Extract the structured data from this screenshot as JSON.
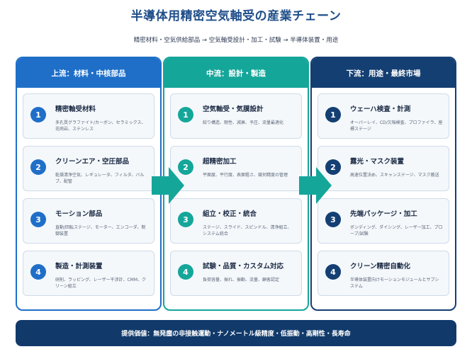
{
  "title": "半導体用精密空気軸受の産業チェーン",
  "subtitle": "精密材料・空気供給部品 → 空気軸受設計・加工・試験 → 半導体装置・用途",
  "colors": {
    "upstream": "#1f6fc8",
    "midstream": "#15a69a",
    "downstream": "#143f73"
  },
  "columns": [
    {
      "header": "上流：材料・中核部品",
      "items": [
        {
          "num": "1",
          "title": "精密軸受材料",
          "desc": "多孔質グラファイト/カーボン、セラミックス、花崗岩、ステンレス"
        },
        {
          "num": "2",
          "title": "クリーンエア・空圧部品",
          "desc": "乾燥清浄空気、レギュレータ、フィルタ、バルブ、配管"
        },
        {
          "num": "3",
          "title": "モーション部品",
          "desc": "直動/回転ステージ、モーター、エンコーダ、制御装置"
        },
        {
          "num": "4",
          "title": "製造・計測装置",
          "desc": "研削、ラッピング、レーザー干渉計、CMM、クリーン組立"
        }
      ]
    },
    {
      "header": "中流：設計・製造",
      "items": [
        {
          "num": "1",
          "title": "空気軸受・気膜設計",
          "desc": "絞り構造、剛性、減衰、予圧、流量最適化"
        },
        {
          "num": "2",
          "title": "超精密加工",
          "desc": "平面度、平行度、表面粗さ、幾何精度の管理"
        },
        {
          "num": "3",
          "title": "組立・校正・統合",
          "desc": "ステージ、スライド、スピンドル、清浄組立、システム統合"
        },
        {
          "num": "4",
          "title": "試験・品質・カスタム対応",
          "desc": "負荷容量、振れ、振動、流量、顧客認定"
        }
      ]
    },
    {
      "header": "下流：用途・最終市場",
      "items": [
        {
          "num": "1",
          "title": "ウェーハ検査・計測",
          "desc": "オーバーレイ、CD/欠陥検査、プロファイラ、座標ステージ"
        },
        {
          "num": "2",
          "title": "露光・マスク装置",
          "desc": "高速位置決め、スキャンステージ、マスク搬送"
        },
        {
          "num": "3",
          "title": "先端パッケージ・加工",
          "desc": "ボンディング、ダイシング、レーザー加工、プローブ/試験"
        },
        {
          "num": "4",
          "title": "クリーン精密自動化",
          "desc": "半導体装置向けモーションモジュールとサブシステム"
        }
      ]
    }
  ],
  "footer": "提供価値：無発塵の非接触運動・ナノメートル級精度・低振動・高剛性・長寿命"
}
